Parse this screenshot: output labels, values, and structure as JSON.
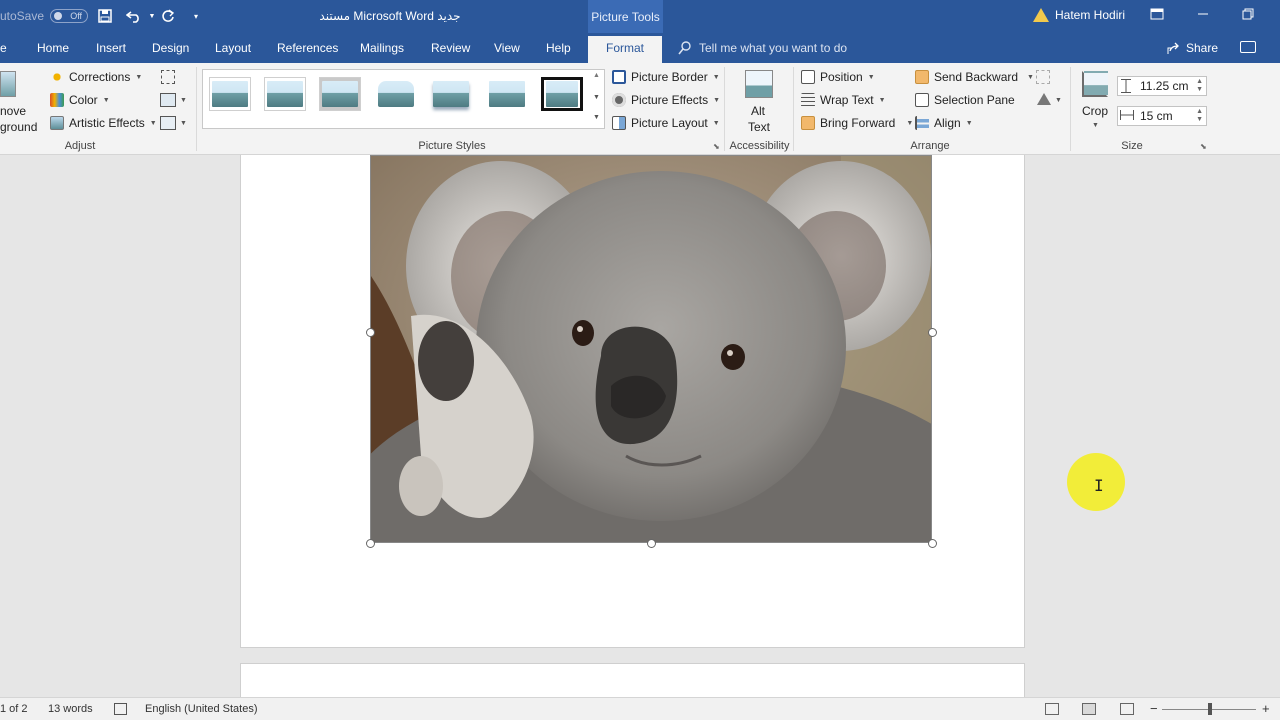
{
  "titlebar": {
    "autosave_label": "utoSave",
    "autosave_state": "Off",
    "document_title": "مستند Microsoft Word جديد",
    "context_tab_group": "Picture Tools",
    "user_name": "Hatem Hodiri"
  },
  "tabs": {
    "items": [
      {
        "label": "e"
      },
      {
        "label": "Home"
      },
      {
        "label": "Insert"
      },
      {
        "label": "Design"
      },
      {
        "label": "Layout"
      },
      {
        "label": "References"
      },
      {
        "label": "Mailings"
      },
      {
        "label": "Review"
      },
      {
        "label": "View"
      },
      {
        "label": "Help"
      }
    ],
    "active": "Format",
    "tell_me": "Tell me what you want to do",
    "share": "Share"
  },
  "ribbon": {
    "remove_bg_line1": "nove",
    "remove_bg_line2": "ground",
    "corrections": "Corrections",
    "color": "Color",
    "artistic": "Artistic Effects",
    "adjust_label": "Adjust",
    "styles_label": "Picture Styles",
    "picture_border": "Picture Border",
    "picture_effects": "Picture Effects",
    "picture_layout": "Picture Layout",
    "alt_text_line1": "Alt",
    "alt_text_line2": "Text",
    "accessibility_label": "Accessibility",
    "position": "Position",
    "wrap_text": "Wrap Text",
    "bring_forward": "Bring Forward",
    "send_backward": "Send Backward",
    "selection_pane": "Selection Pane",
    "align": "Align",
    "arrange_label": "Arrange",
    "crop": "Crop",
    "height_value": "11.25 cm",
    "width_value": "15 cm",
    "size_label": "Size"
  },
  "status": {
    "page": "1 of 2",
    "words": "13 words",
    "language": "English (United States)"
  }
}
